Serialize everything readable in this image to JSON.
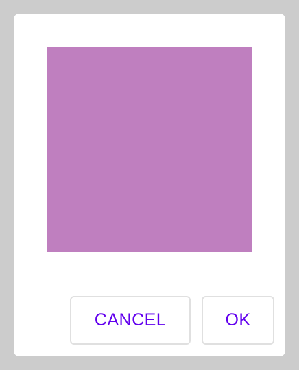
{
  "dialog": {
    "swatch_color": "#bf7fbf",
    "accent_color": "#6200ee",
    "cancel_label": "CANCEL",
    "ok_label": "OK"
  }
}
